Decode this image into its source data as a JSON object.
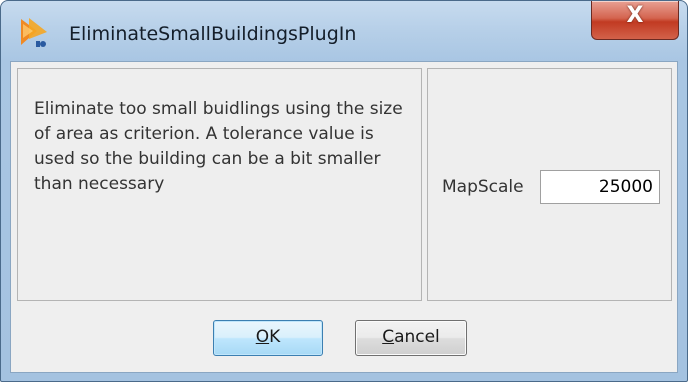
{
  "window": {
    "title": "EliminateSmallBuildingsPlugIn",
    "close_glyph": "X",
    "icon": "openjump-plugin-icon"
  },
  "description": {
    "text": "Eliminate too small buidlings using the size of area as criterion. A tolerance value is used so the building can be a bit smaller than necessary"
  },
  "form": {
    "mapscale_label": "MapScale",
    "mapscale_value": "25000"
  },
  "buttons": {
    "ok_mnemonic": "O",
    "ok_rest": "K",
    "cancel_mnemonic": "C",
    "cancel_rest": "ancel"
  },
  "colors": {
    "titlebar": "#b6cfe8",
    "close_button": "#c13a22",
    "dialog_background": "#efefef",
    "ok_button_highlight": "#bee6fd"
  }
}
